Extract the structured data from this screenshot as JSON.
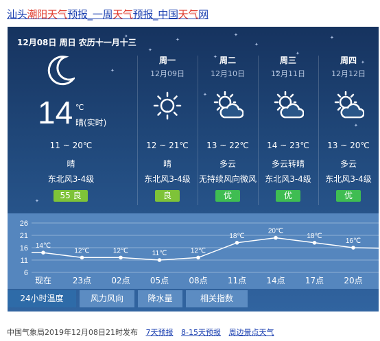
{
  "header": {
    "link_part1": "汕头",
    "link_part2": "潮阳",
    "link_part3": "天气",
    "link_part4": "预报_一周",
    "link_part5": "天气",
    "link_part6": "预报_中国",
    "link_part7": "天气",
    "link_part8": "网"
  },
  "today": {
    "date_line": "12月08日 周日 农历十一月十三",
    "icon": "moon-icon",
    "temp": "14",
    "unit": "℃",
    "desc": "晴(实时)",
    "range": "11 ~ 20℃",
    "weather": "晴",
    "wind": "东北风3-4级",
    "aqi": "55 良"
  },
  "days": [
    {
      "weekday": "周一",
      "date": "12月09日",
      "icon": "sun-icon",
      "range": "12 ~ 21℃",
      "weather": "晴",
      "wind": "东北风3-4级",
      "aqi": "良"
    },
    {
      "weekday": "周二",
      "date": "12月10日",
      "icon": "partly-cloudy-icon",
      "range": "13 ~ 22℃",
      "weather": "多云",
      "wind": "无持续风向微风",
      "aqi": "优"
    },
    {
      "weekday": "周三",
      "date": "12月11日",
      "icon": "partly-cloudy-icon",
      "range": "14 ~ 23℃",
      "weather": "多云转晴",
      "wind": "东北风3-4级",
      "aqi": "优"
    },
    {
      "weekday": "周四",
      "date": "12月12日",
      "icon": "partly-cloudy-icon",
      "range": "13 ~ 20℃",
      "weather": "多云",
      "wind": "东北风3-4级",
      "aqi": "优"
    }
  ],
  "chart_data": {
    "type": "line",
    "categories": [
      "现在",
      "23点",
      "02点",
      "05点",
      "08点",
      "11点",
      "14点",
      "17点",
      "20点"
    ],
    "values": [
      14,
      12,
      12,
      11,
      12,
      18,
      20,
      18,
      16
    ],
    "data_labels": [
      "14℃",
      "12℃",
      "12℃",
      "11℃",
      "12℃",
      "18℃",
      "20℃",
      "18℃",
      "16℃"
    ],
    "y_ticks": [
      6,
      11,
      16,
      21,
      26
    ],
    "ylim": [
      6,
      26
    ],
    "grid": true,
    "line_color": "#ffffff"
  },
  "tabs": [
    "24小时温度",
    "风力风向",
    "降水量",
    "相关指数"
  ],
  "footer": {
    "publish": "中国气象局2019年12月08日21时发布",
    "links": [
      "7天预报",
      "8-15天预报",
      "周边景点天气"
    ]
  },
  "colors": {
    "bg_top": "#16335f",
    "bg_bottom": "#3164a0",
    "aqi_liang": "#7ec338",
    "aqi_you": "#3fbd52",
    "chart_bg": "#5586be"
  }
}
